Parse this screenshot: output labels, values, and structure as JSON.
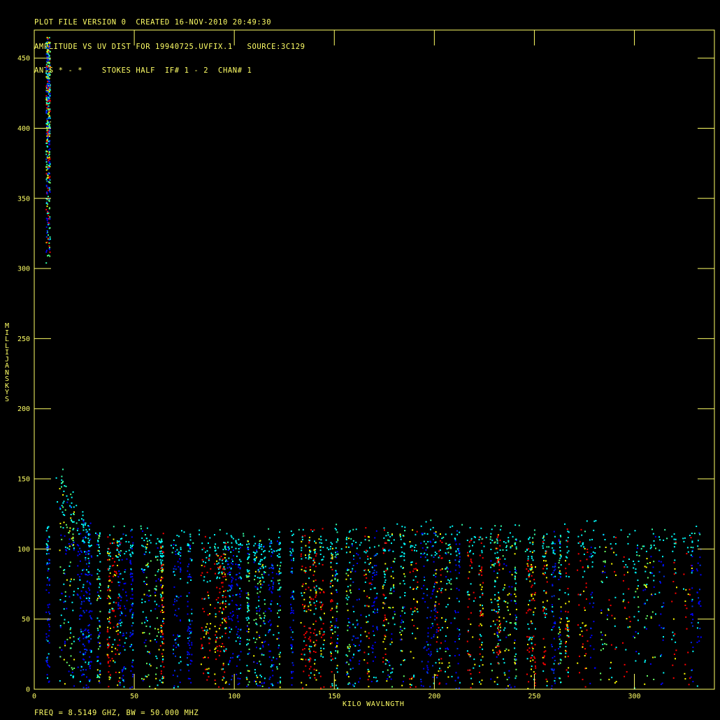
{
  "header": {
    "line1": "PLOT FILE VERSION 0  CREATED 16-NOV-2010 20:49:30",
    "line2": "AMPLITUDE VS UV DIST FOR 19940725.UVFIX.1   SOURCE:3C129",
    "line3": "ANTS * - *    STOKES HALF  IF# 1 - 2  CHAN# 1"
  },
  "footer": "FREQ = 8.5149 GHZ, BW = 50.000 MHZ",
  "colors": {
    "axis": "#ffff66",
    "points": [
      "#0000ff",
      "#0033ee",
      "#00ffff",
      "#33ffaa",
      "#66ff66",
      "#ffff00",
      "#ff0000"
    ]
  },
  "chart_data": {
    "type": "scatter",
    "title": "AMPLITUDE VS UV DIST FOR 19940725.UVFIX.1   SOURCE:3C129",
    "xlabel": "KILO WAVLNGTH",
    "ylabel": "MILLIJANSKYS",
    "xlim": [
      0,
      340
    ],
    "ylim": [
      0,
      470
    ],
    "x_ticks": [
      0,
      50,
      100,
      150,
      200,
      250,
      300
    ],
    "y_ticks": [
      0,
      50,
      100,
      150,
      200,
      250,
      300,
      350,
      400,
      450
    ],
    "grid": false,
    "series": [
      {
        "description": "short-baseline points",
        "x_range": [
          6,
          8
        ],
        "y_range": [
          300,
          465
        ]
      },
      {
        "description": "bulk of visibilities",
        "x_range": [
          6,
          333
        ],
        "y_range": [
          0,
          120
        ]
      }
    ],
    "envelope": [
      {
        "x": 7,
        "y": 138
      },
      {
        "x": 14,
        "y": 148
      },
      {
        "x": 20,
        "y": 125
      },
      {
        "x": 30,
        "y": 112
      },
      {
        "x": 50,
        "y": 108
      },
      {
        "x": 100,
        "y": 105
      },
      {
        "x": 150,
        "y": 110
      },
      {
        "x": 200,
        "y": 112
      },
      {
        "x": 250,
        "y": 108
      },
      {
        "x": 280,
        "y": 112
      },
      {
        "x": 300,
        "y": 105
      },
      {
        "x": 333,
        "y": 112
      }
    ]
  }
}
